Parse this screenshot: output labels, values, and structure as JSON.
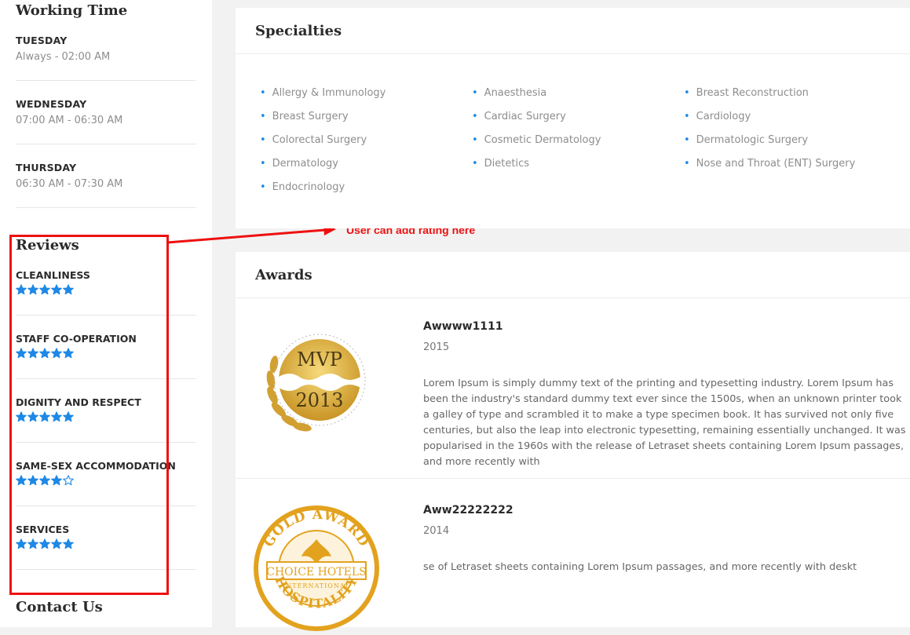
{
  "sidebar": {
    "working_time_title": "Working Time",
    "days": [
      {
        "name": "TUESDAY",
        "hours": "Always - 02:00 AM"
      },
      {
        "name": "WEDNESDAY",
        "hours": "07:00 AM - 06:30 AM"
      },
      {
        "name": "THURSDAY",
        "hours": "06:30 AM - 07:30 AM"
      }
    ],
    "reviews_title": "Reviews",
    "reviews": [
      {
        "name": "CLEANLINESS",
        "rating": 5
      },
      {
        "name": "STAFF CO-OPERATION",
        "rating": 5
      },
      {
        "name": "DIGNITY AND RESPECT",
        "rating": 5
      },
      {
        "name": "SAME-SEX ACCOMMODATION",
        "rating": 4
      },
      {
        "name": "SERVICES",
        "rating": 5
      }
    ],
    "contact_title": "Contact Us"
  },
  "annotation": {
    "text": "User can add rating here",
    "color": "#ee1111"
  },
  "specialties": {
    "title": "Specialties",
    "columns": [
      [
        "Allergy & Immunology",
        "Breast Surgery",
        "Colorectal Surgery",
        "Dermatology",
        "Endocrinology"
      ],
      [
        "Anaesthesia",
        "Cardiac Surgery",
        "Cosmetic Dermatology",
        "Dietetics"
      ],
      [
        "Breast Reconstruction",
        "Cardiology",
        "Dermatologic Surgery",
        "Nose and Throat (ENT) Surgery"
      ]
    ]
  },
  "awards": {
    "title": "Awards",
    "items": [
      {
        "title": "Awwww1111",
        "year": "2015",
        "text": "Lorem Ipsum is simply dummy text of the printing and typesetting industry. Lorem Ipsum has been the industry's standard dummy text ever since the 1500s, when an unknown printer took a galley of type and scrambled it to make a type specimen book. It has survived not only five centuries, but also the leap into electronic typesetting, remaining essentially unchanged. It was popularised in the 1960s with the release of Letraset sheets containing Lorem Ipsum passages, and more recently with",
        "badge": {
          "line1": "MVP",
          "line2": "2013"
        }
      },
      {
        "title": "Aww22222222",
        "year": "2014",
        "text": "se of Letraset sheets containing Lorem Ipsum passages, and more recently with deskt",
        "badge": {
          "top": "GOLD AWARD",
          "middle": "CHOICE HOTELS",
          "sub": "INTERNATIONAL",
          "bottom": "HOSPITALITY"
        }
      }
    ]
  },
  "colors": {
    "star": "#1e88e5",
    "bullet": "#1e88e5",
    "gold": "#d8a634"
  }
}
